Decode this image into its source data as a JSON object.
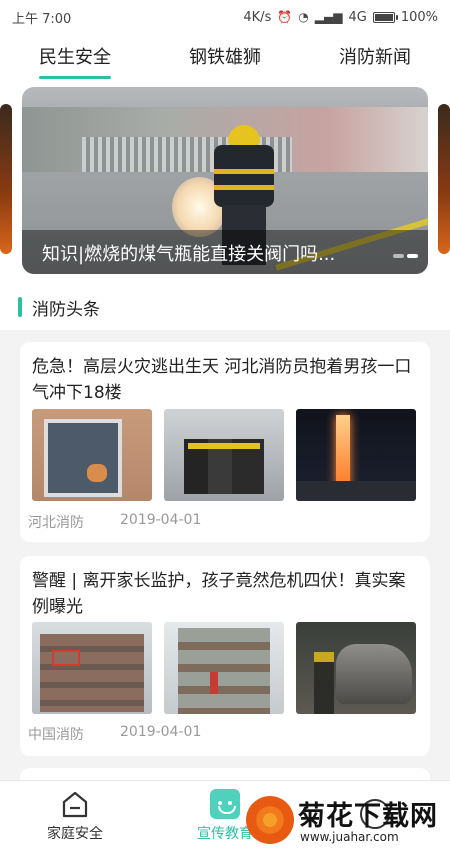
{
  "status_bar": {
    "time": "上午 7:00",
    "speed": "4K/s",
    "network": "4G",
    "battery": "100%"
  },
  "tabs": [
    {
      "label": "民生安全",
      "active": true
    },
    {
      "label": "钢铁雄狮",
      "active": false
    },
    {
      "label": "消防新闻",
      "active": false
    }
  ],
  "banner": {
    "caption": "知识|燃烧的煤气瓶能直接关阀门吗...",
    "slide_count": 2,
    "active_slide": 2
  },
  "section": {
    "title": "消防头条"
  },
  "news": [
    {
      "title": "危急！高层火灾逃出生天 河北消防员抱着男孩一口气冲下18楼",
      "source": "河北消防",
      "date": "2019-04-01"
    },
    {
      "title": "警醒 | 离开家长监护，孩子竟然危机四伏！真实案例曝光",
      "source": "中国消防",
      "date": "2019-04-01"
    }
  ],
  "bottom_nav": [
    {
      "label": "家庭安全",
      "icon": "home-icon",
      "active": false
    },
    {
      "label": "宣传教育",
      "icon": "education-icon",
      "active": true
    },
    {
      "label": "",
      "icon": "profile-icon",
      "active": false
    }
  ],
  "watermark": {
    "text": "菊花下载网",
    "url": "www.juahar.com"
  },
  "colors": {
    "accent": "#2dbfa5",
    "nav_active": "#4fd1bc"
  }
}
